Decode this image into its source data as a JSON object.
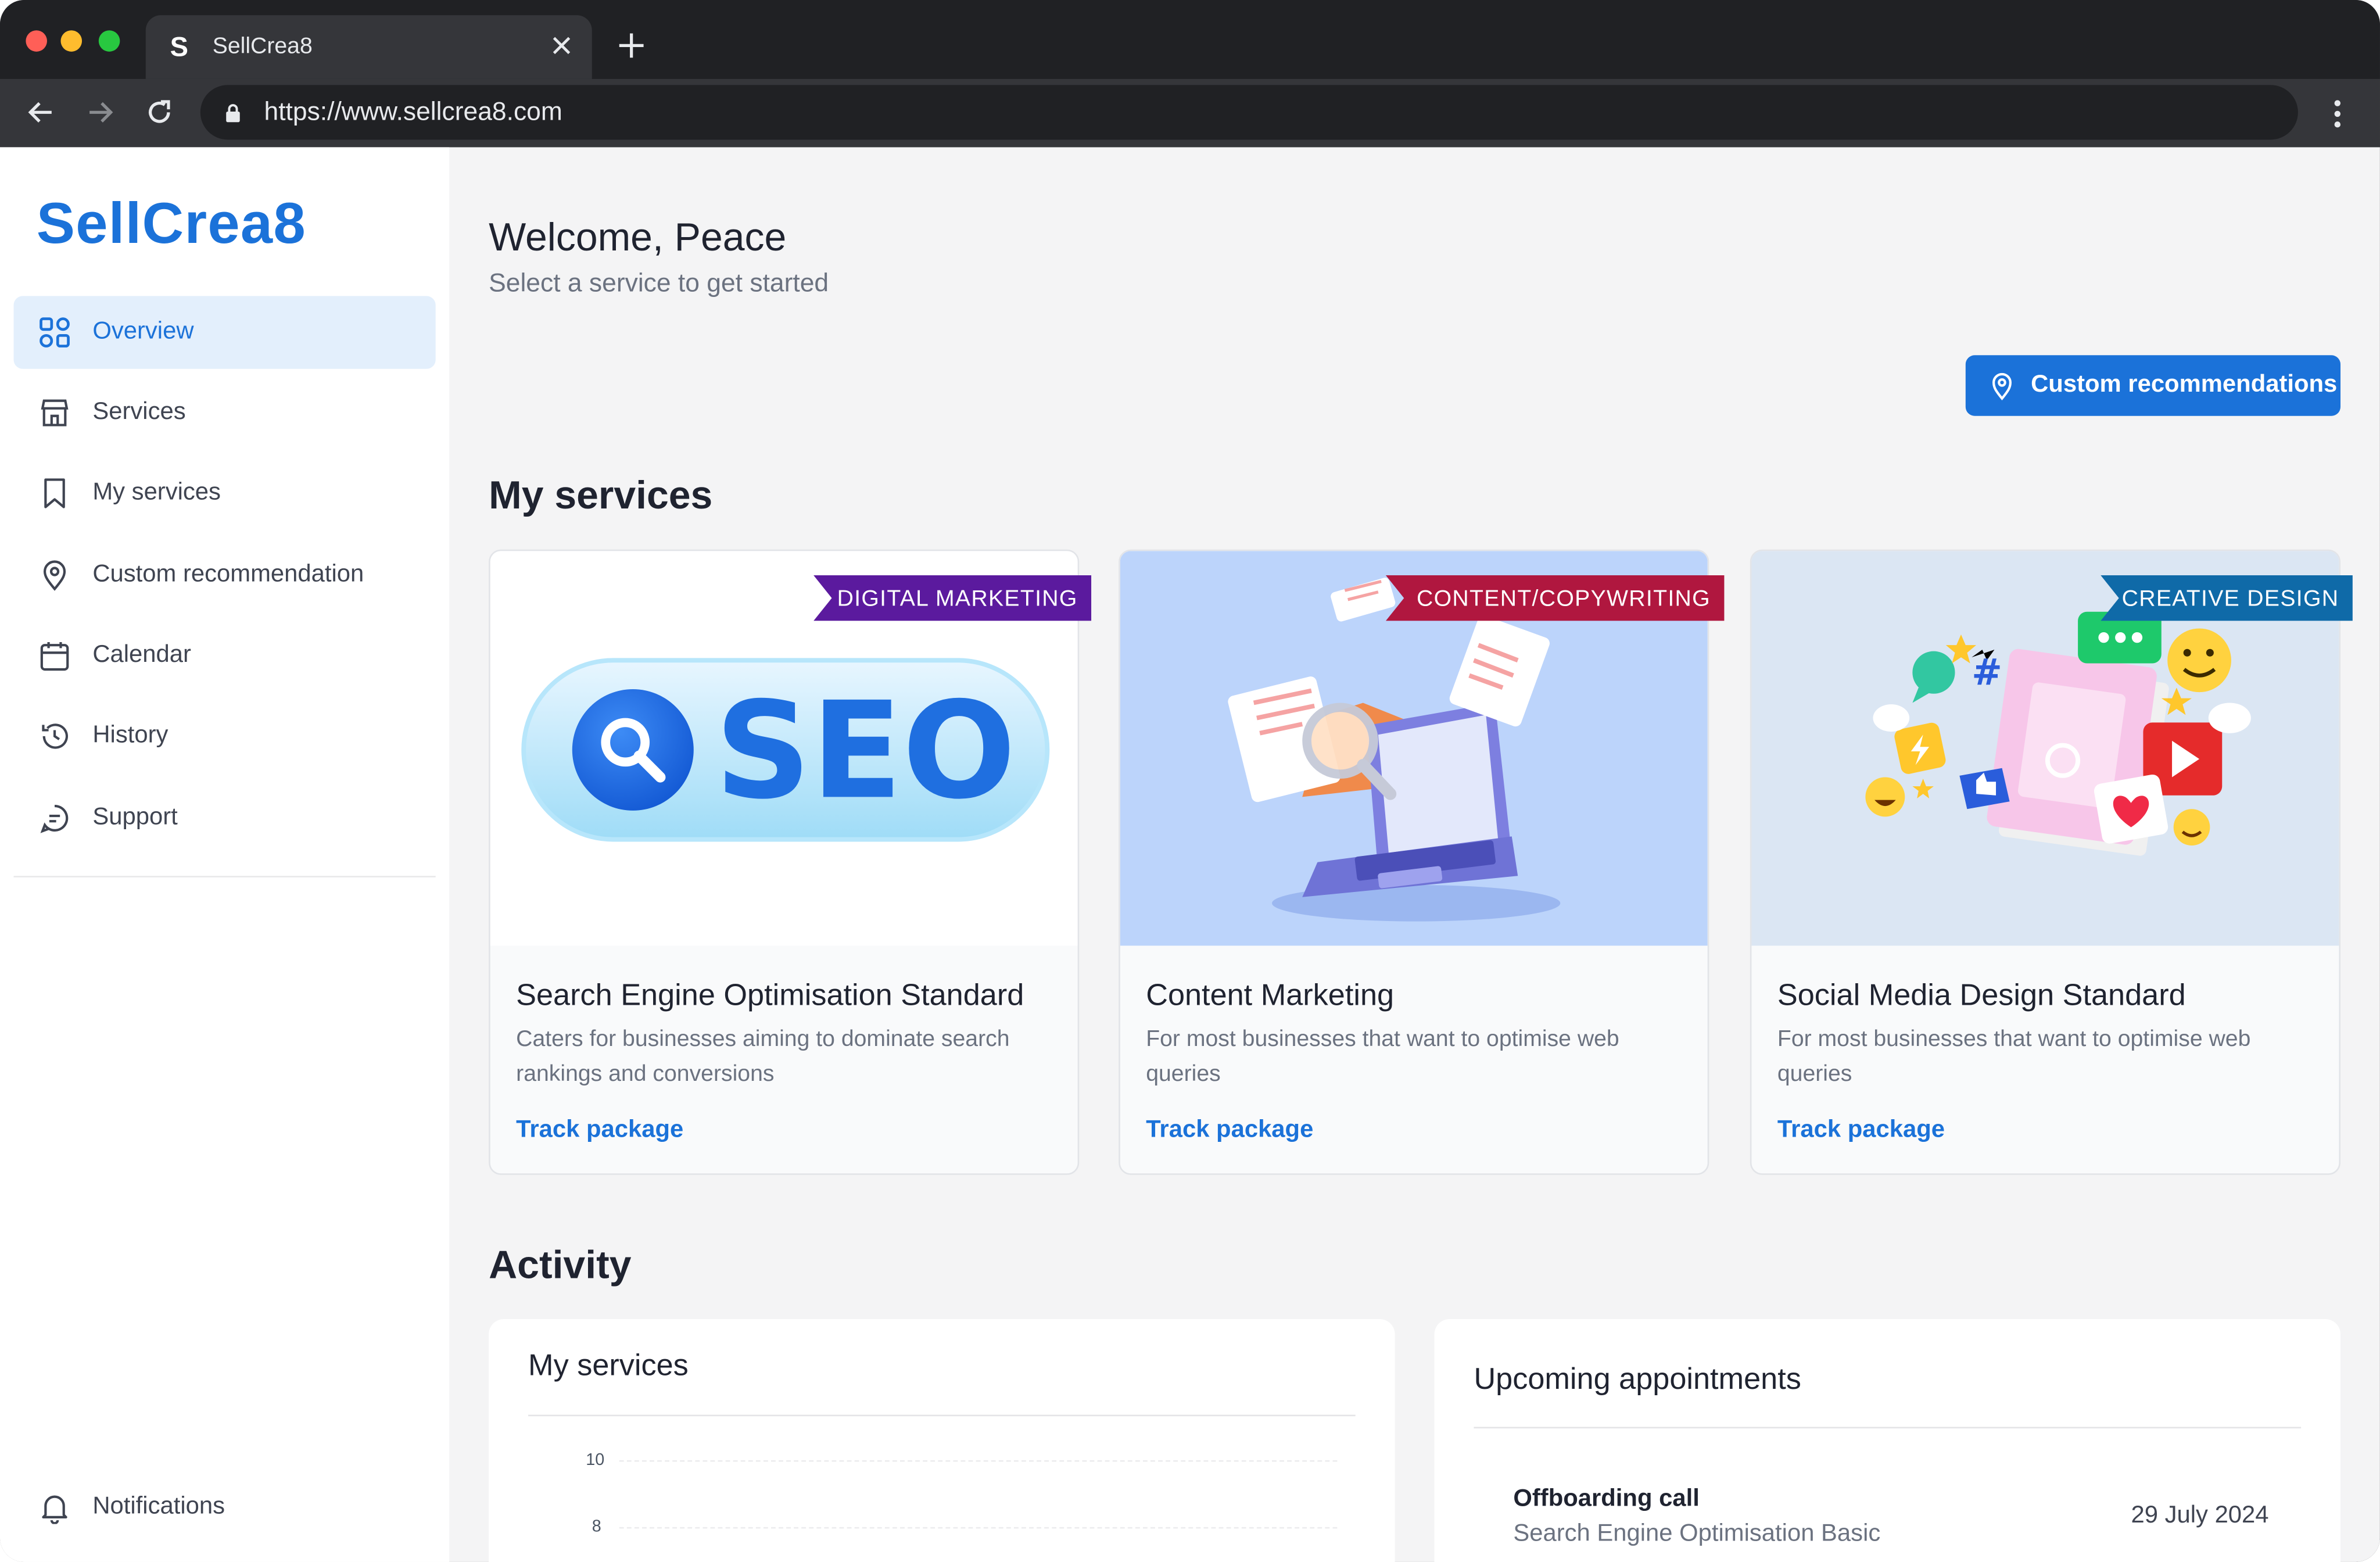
{
  "browser": {
    "tab_title": "SellCrea8",
    "favicon": "S",
    "url": "https://www.sellcrea8.com",
    "traffic_lights": [
      "#ff5f57",
      "#febc2e",
      "#28c840"
    ]
  },
  "sidebar": {
    "logo": "SellCrea8",
    "items": [
      {
        "label": "Overview",
        "icon": "grid-icon",
        "active": true
      },
      {
        "label": "Services",
        "icon": "store-icon"
      },
      {
        "label": "My services",
        "icon": "bookmark-icon"
      },
      {
        "label": "Custom recommendation",
        "icon": "location-pin-icon"
      },
      {
        "label": "Calendar",
        "icon": "calendar-icon"
      },
      {
        "label": "History",
        "icon": "history-icon"
      },
      {
        "label": "Support",
        "icon": "chat-icon"
      }
    ],
    "notifications_label": "Notifications"
  },
  "header": {
    "welcome": "Welcome, Peace",
    "subtitle": "Select a service to get started"
  },
  "custom_recommendations_button": "Custom recommendations",
  "my_services": {
    "title": "My services",
    "cards": [
      {
        "tag": "DIGITAL MARKETING",
        "tag_color": "#5b1a9e",
        "image_text": "SEO",
        "title": "Search Engine Optimisation Standard",
        "description": "Caters for businesses aiming to dominate search rankings and conversions",
        "link": "Track package"
      },
      {
        "tag": "CONTENT/COPYWRITING",
        "tag_color": "#b0173f",
        "title": "Content Marketing",
        "description": "For most businesses that want to optimise web queries",
        "link": "Track package"
      },
      {
        "tag": "CREATIVE DESIGN",
        "tag_color": "#0f6aa8",
        "title": "Social Media Design Standard",
        "description": "For most businesses that want to optimise web queries",
        "link": "Track package"
      }
    ]
  },
  "activity": {
    "title": "Activity",
    "my_services_panel": {
      "title": "My services",
      "y_ticks": [
        "10",
        "8"
      ]
    },
    "appointments_panel": {
      "title": "Upcoming appointments",
      "items": [
        {
          "title": "Offboarding call",
          "subtitle": "Search Engine Optimisation Basic",
          "date": "29 July 2024"
        }
      ]
    }
  },
  "colors": {
    "accent": "#1b72d9",
    "active_bg": "#e3effc"
  }
}
